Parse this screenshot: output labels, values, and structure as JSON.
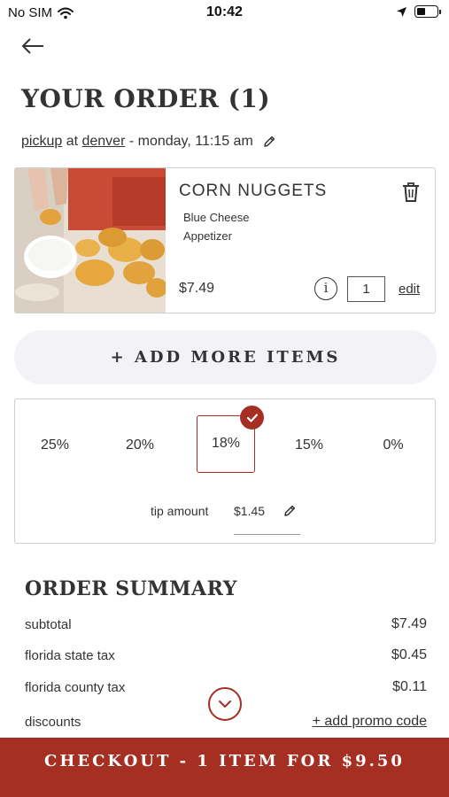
{
  "status_bar": {
    "carrier": "No SIM",
    "time": "10:42"
  },
  "page": {
    "title": "YOUR ORDER (1)"
  },
  "pickup": {
    "mode": "pickup",
    "at": " at ",
    "location": "denver",
    "when": " - monday, 11:15 am"
  },
  "item": {
    "name": "CORN NUGGETS",
    "detail1": "Blue Cheese",
    "detail2": "Appetizer",
    "price": "$7.49",
    "info_symbol": "i",
    "quantity": "1",
    "edit_label": "edit"
  },
  "add_more": {
    "label": "+ ADD MORE ITEMS"
  },
  "tip": {
    "options": [
      "25%",
      "20%",
      "18%",
      "15%",
      "0%"
    ],
    "selected": "18%",
    "amount_label": "tip amount",
    "amount_value": "$1.45"
  },
  "summary": {
    "title": "ORDER SUMMARY",
    "rows": [
      {
        "label": "subtotal",
        "value": "$7.49"
      },
      {
        "label": "florida state tax",
        "value": "$0.45"
      },
      {
        "label": "florida county tax",
        "value": "$0.11"
      },
      {
        "label": "discounts",
        "value": "+ add promo code"
      }
    ]
  },
  "checkout": {
    "label": "CHECKOUT - 1 ITEM FOR $9.50"
  },
  "colors": {
    "brand": "#a42f22",
    "button_bg": "#f3f3f7"
  }
}
